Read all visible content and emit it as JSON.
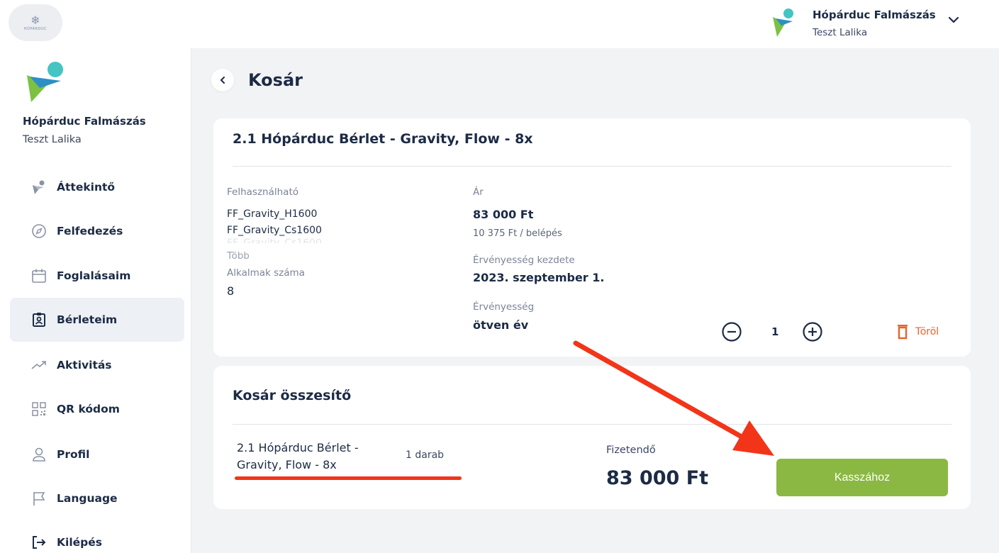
{
  "app": {
    "logo_text": "HÓPÁRDUC",
    "org_name": "Hópárduc Falmászás",
    "user_name": "Teszt Lalika"
  },
  "sidebar": {
    "org_name": "Hópárduc Falmászás",
    "user_name": "Teszt Lalika",
    "items": [
      {
        "label": "Áttekintő",
        "icon": "climber-icon"
      },
      {
        "label": "Felfedezés",
        "icon": "compass-icon"
      },
      {
        "label": "Foglalásaim",
        "icon": "calendar-icon"
      },
      {
        "label": "Bérleteim",
        "icon": "pass-icon",
        "active": true
      },
      {
        "label": "Aktivitás",
        "icon": "trend-icon"
      },
      {
        "label": "QR kódom",
        "icon": "qr-icon"
      },
      {
        "label": "Profil",
        "icon": "user-icon"
      },
      {
        "label": "Language",
        "icon": "flag-icon"
      },
      {
        "label": "Kilépés",
        "icon": "logout-icon"
      }
    ]
  },
  "page": {
    "title": "Kosár"
  },
  "cart_item": {
    "title": "2.1 Hópárduc Bérlet - Gravity, Flow - 8x",
    "usable_label": "Felhasználható",
    "usable_values": [
      "FF_Gravity_H1600",
      "FF_Gravity_Cs1600"
    ],
    "more_label": "Több",
    "sessions_label": "Alkalmak száma",
    "sessions_value": "8",
    "price_label": "Ár",
    "price_value": "83 000 Ft",
    "price_per_entry": "10 375 Ft / belépés",
    "valid_from_label": "Érvényesség kezdete",
    "valid_from_value": "2023. szeptember 1.",
    "validity_label": "Érvényesség",
    "validity_value": "ötven év",
    "quantity": "1",
    "delete_label": "Töröl"
  },
  "summary": {
    "title": "Kosár összesítő",
    "item_name": "2.1 Hópárduc Bérlet - Gravity, Flow - 8x",
    "item_qty": "1 darab",
    "payable_label": "Fizetendő",
    "payable_total": "83 000 Ft",
    "checkout_label": "Kasszához"
  },
  "colors": {
    "accent_green": "#8ab842",
    "delete_orange": "#e8632b",
    "annotation_red": "#f23519",
    "brand_teal": "#45c4c4",
    "brand_green": "#7cc142"
  }
}
